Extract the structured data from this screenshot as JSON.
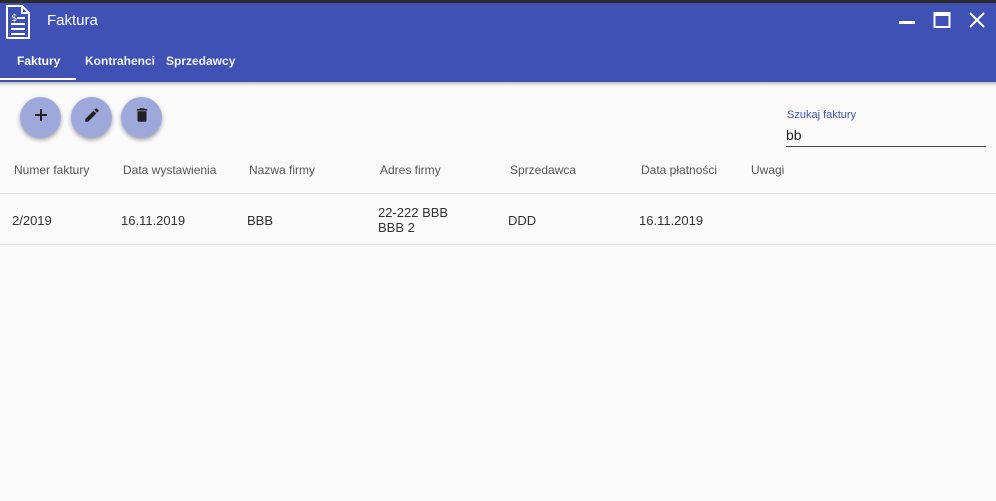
{
  "window": {
    "title": "Faktura",
    "app_icon": "invoice-document-icon",
    "controls": [
      "minimize-icon",
      "maximize-icon",
      "close-icon"
    ]
  },
  "tabs": [
    {
      "label": "Faktury",
      "active": true
    },
    {
      "label": "Kontrahenci",
      "active": false
    },
    {
      "label": "Sprzedawcy",
      "active": false
    }
  ],
  "toolbar": {
    "buttons": [
      "plus-icon",
      "pencil-icon",
      "trash-icon"
    ]
  },
  "search": {
    "label": "Szukaj faktury",
    "value": "bb"
  },
  "table": {
    "columns": [
      "Numer faktury",
      "Data wystawienia",
      "Nazwa firmy",
      "Adres firmy",
      "Sprzedawca",
      "Data płatności",
      "Uwagi"
    ],
    "rows": [
      {
        "numer": "2/2019",
        "data_wystawienia": "16.11.2019",
        "nazwa_firmy": "BBB",
        "adres_line1": "22-222 BBB",
        "adres_line2": "BBB 2",
        "sprzedawca": "DDD",
        "data_platnosci": "16.11.2019",
        "uwagi": ""
      }
    ]
  },
  "colors": {
    "primary": "#3f51b5",
    "fab": "#9fa8da",
    "background": "#fafafa"
  }
}
